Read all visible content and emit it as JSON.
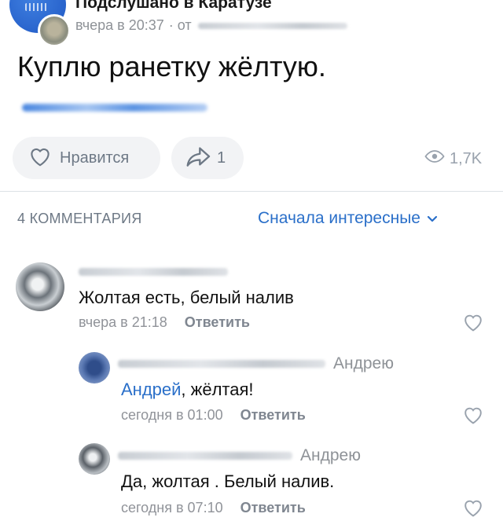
{
  "post": {
    "group_name": "Подслушано в Каратузе",
    "time": "вчера в 20:37",
    "from_label": "· от",
    "text": "Куплю ранетку жёлтую.",
    "like_label": "Нравится",
    "share_count": "1",
    "views": "1,7K"
  },
  "comments_header": {
    "count_label": "4 КОММЕНТАРИЯ",
    "sort_label": "Сначала интересные"
  },
  "comments": [
    {
      "text": "Жолтая есть, белый налив",
      "time": "вчера в 21:18",
      "reply_label": "Ответить"
    },
    {
      "to": "Андрею",
      "mention": "Андрей",
      "text": ", жёлтая!",
      "time": "сегодня в 01:00",
      "reply_label": "Ответить"
    },
    {
      "to": "Андрею",
      "text": "Да, жолтая . Белый налив.",
      "time": "сегодня в 07:10",
      "reply_label": "Ответить"
    }
  ],
  "colors": {
    "accent": "#2a6fc9",
    "secondary_text": "#909399",
    "pill_bg": "#f2f3f5"
  },
  "icons": [
    "heart-icon",
    "share-icon",
    "eye-icon",
    "chevron-down-icon"
  ]
}
